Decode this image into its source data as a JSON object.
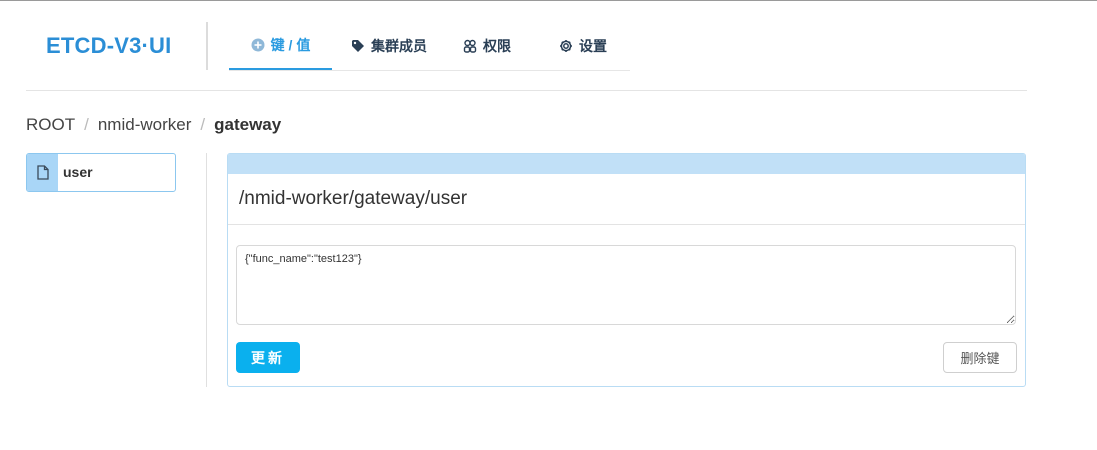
{
  "app": {
    "title": "ETCD-V3·UI"
  },
  "nav": {
    "tabs": [
      {
        "label": "键 / 值",
        "icon": "plus-circle-icon",
        "active": true
      },
      {
        "label": "集群成员",
        "icon": "tag-icon",
        "active": false
      },
      {
        "label": "权限",
        "icon": "users-icon",
        "active": false
      },
      {
        "label": "设置",
        "icon": "gear-icon",
        "active": false
      }
    ]
  },
  "breadcrumb": {
    "items": [
      "ROOT",
      "nmid-worker",
      "gateway"
    ],
    "separator": "/"
  },
  "keys": {
    "items": [
      {
        "label": "user",
        "icon": "file-icon"
      }
    ]
  },
  "editor": {
    "path": "/nmid-worker/gateway/user",
    "value": "{\"func_name\":\"test123\"}",
    "update_label": "更新",
    "delete_label": "删除键"
  },
  "colors": {
    "accent": "#2a9be0",
    "logo": "#2b8ed6",
    "panel_header": "#c1e0f7",
    "button_primary": "#0ab0ee"
  }
}
